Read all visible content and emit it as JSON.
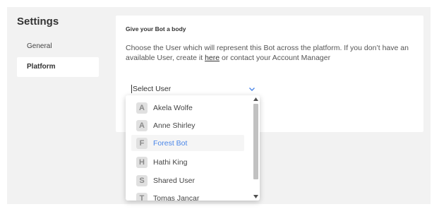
{
  "sidebar": {
    "title": "Settings",
    "items": [
      {
        "label": "General"
      },
      {
        "label": "Platform"
      }
    ]
  },
  "card": {
    "title": "Give your Bot a body",
    "description_before_link": "Choose the User which will represent this Bot across the platform. If you don’t have an available User, create it ",
    "link_text": "here",
    "description_after_link": " or contact your Account Manager"
  },
  "select": {
    "placeholder": "Select User"
  },
  "dropdown": {
    "options": [
      {
        "initial": "A",
        "label": "Akela Wolfe"
      },
      {
        "initial": "A",
        "label": "Anne Shirley"
      },
      {
        "initial": "F",
        "label": "Forest Bot"
      },
      {
        "initial": "H",
        "label": "Hathi King"
      },
      {
        "initial": "S",
        "label": "Shared User"
      },
      {
        "initial": "T",
        "label": "Tomas Jancar"
      }
    ],
    "highlighted_option": "Forest Bot"
  },
  "colors": {
    "accent": "#4a86e8",
    "background": "#f2f2f2",
    "card": "#ffffff"
  }
}
